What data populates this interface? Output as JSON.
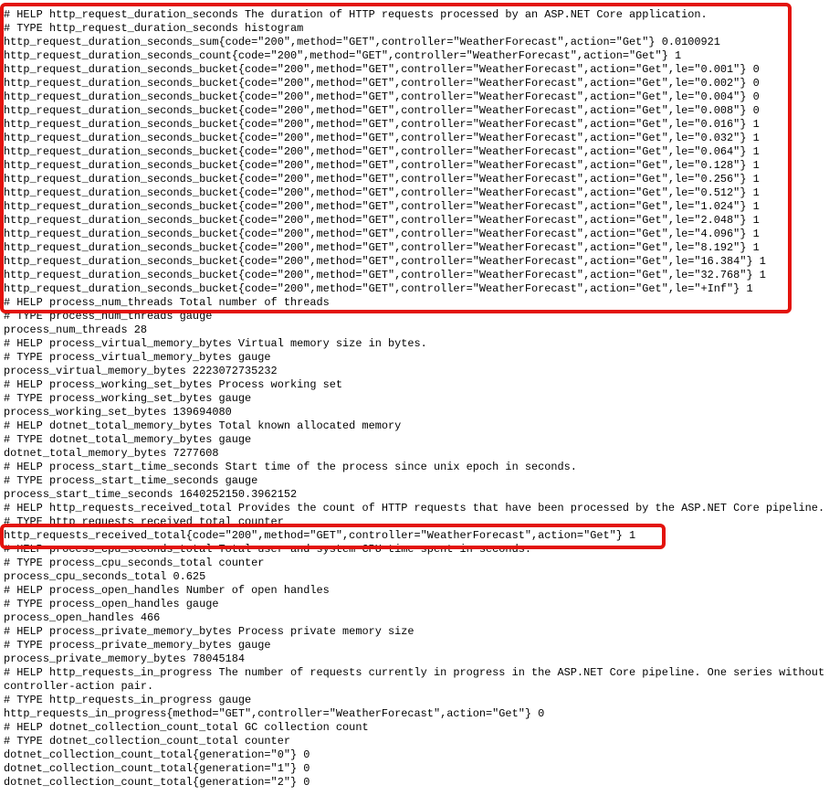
{
  "highlight_color": "#e3120b",
  "lines": [
    "# HELP http_request_duration_seconds The duration of HTTP requests processed by an ASP.NET Core application.",
    "# TYPE http_request_duration_seconds histogram",
    "http_request_duration_seconds_sum{code=\"200\",method=\"GET\",controller=\"WeatherForecast\",action=\"Get\"} 0.0100921",
    "http_request_duration_seconds_count{code=\"200\",method=\"GET\",controller=\"WeatherForecast\",action=\"Get\"} 1",
    "http_request_duration_seconds_bucket{code=\"200\",method=\"GET\",controller=\"WeatherForecast\",action=\"Get\",le=\"0.001\"} 0",
    "http_request_duration_seconds_bucket{code=\"200\",method=\"GET\",controller=\"WeatherForecast\",action=\"Get\",le=\"0.002\"} 0",
    "http_request_duration_seconds_bucket{code=\"200\",method=\"GET\",controller=\"WeatherForecast\",action=\"Get\",le=\"0.004\"} 0",
    "http_request_duration_seconds_bucket{code=\"200\",method=\"GET\",controller=\"WeatherForecast\",action=\"Get\",le=\"0.008\"} 0",
    "http_request_duration_seconds_bucket{code=\"200\",method=\"GET\",controller=\"WeatherForecast\",action=\"Get\",le=\"0.016\"} 1",
    "http_request_duration_seconds_bucket{code=\"200\",method=\"GET\",controller=\"WeatherForecast\",action=\"Get\",le=\"0.032\"} 1",
    "http_request_duration_seconds_bucket{code=\"200\",method=\"GET\",controller=\"WeatherForecast\",action=\"Get\",le=\"0.064\"} 1",
    "http_request_duration_seconds_bucket{code=\"200\",method=\"GET\",controller=\"WeatherForecast\",action=\"Get\",le=\"0.128\"} 1",
    "http_request_duration_seconds_bucket{code=\"200\",method=\"GET\",controller=\"WeatherForecast\",action=\"Get\",le=\"0.256\"} 1",
    "http_request_duration_seconds_bucket{code=\"200\",method=\"GET\",controller=\"WeatherForecast\",action=\"Get\",le=\"0.512\"} 1",
    "http_request_duration_seconds_bucket{code=\"200\",method=\"GET\",controller=\"WeatherForecast\",action=\"Get\",le=\"1.024\"} 1",
    "http_request_duration_seconds_bucket{code=\"200\",method=\"GET\",controller=\"WeatherForecast\",action=\"Get\",le=\"2.048\"} 1",
    "http_request_duration_seconds_bucket{code=\"200\",method=\"GET\",controller=\"WeatherForecast\",action=\"Get\",le=\"4.096\"} 1",
    "http_request_duration_seconds_bucket{code=\"200\",method=\"GET\",controller=\"WeatherForecast\",action=\"Get\",le=\"8.192\"} 1",
    "http_request_duration_seconds_bucket{code=\"200\",method=\"GET\",controller=\"WeatherForecast\",action=\"Get\",le=\"16.384\"} 1",
    "http_request_duration_seconds_bucket{code=\"200\",method=\"GET\",controller=\"WeatherForecast\",action=\"Get\",le=\"32.768\"} 1",
    "http_request_duration_seconds_bucket{code=\"200\",method=\"GET\",controller=\"WeatherForecast\",action=\"Get\",le=\"+Inf\"} 1",
    "# HELP process_num_threads Total number of threads",
    "# TYPE process_num_threads gauge",
    "process_num_threads 28",
    "# HELP process_virtual_memory_bytes Virtual memory size in bytes.",
    "# TYPE process_virtual_memory_bytes gauge",
    "process_virtual_memory_bytes 2223072735232",
    "# HELP process_working_set_bytes Process working set",
    "# TYPE process_working_set_bytes gauge",
    "process_working_set_bytes 139694080",
    "# HELP dotnet_total_memory_bytes Total known allocated memory",
    "# TYPE dotnet_total_memory_bytes gauge",
    "dotnet_total_memory_bytes 7277608",
    "# HELP process_start_time_seconds Start time of the process since unix epoch in seconds.",
    "# TYPE process_start_time_seconds gauge",
    "process_start_time_seconds 1640252150.3962152",
    "# HELP http_requests_received_total Provides the count of HTTP requests that have been processed by the ASP.NET Core pipeline.",
    "# TYPE http_requests_received_total counter",
    "http_requests_received_total{code=\"200\",method=\"GET\",controller=\"WeatherForecast\",action=\"Get\"} 1",
    "# HELP process_cpu_seconds_total Total user and system CPU time spent in seconds.",
    "# TYPE process_cpu_seconds_total counter",
    "process_cpu_seconds_total 0.625",
    "# HELP process_open_handles Number of open handles",
    "# TYPE process_open_handles gauge",
    "process_open_handles 466",
    "# HELP process_private_memory_bytes Process private memory size",
    "# TYPE process_private_memory_bytes gauge",
    "process_private_memory_bytes 78045184",
    "# HELP http_requests_in_progress The number of requests currently in progress in the ASP.NET Core pipeline. One series without controller-action pair.",
    "# TYPE http_requests_in_progress gauge",
    "http_requests_in_progress{method=\"GET\",controller=\"WeatherForecast\",action=\"Get\"} 0",
    "# HELP dotnet_collection_count_total GC collection count",
    "# TYPE dotnet_collection_count_total counter",
    "dotnet_collection_count_total{generation=\"0\"} 0",
    "dotnet_collection_count_total{generation=\"1\"} 0",
    "dotnet_collection_count_total{generation=\"2\"} 0"
  ]
}
